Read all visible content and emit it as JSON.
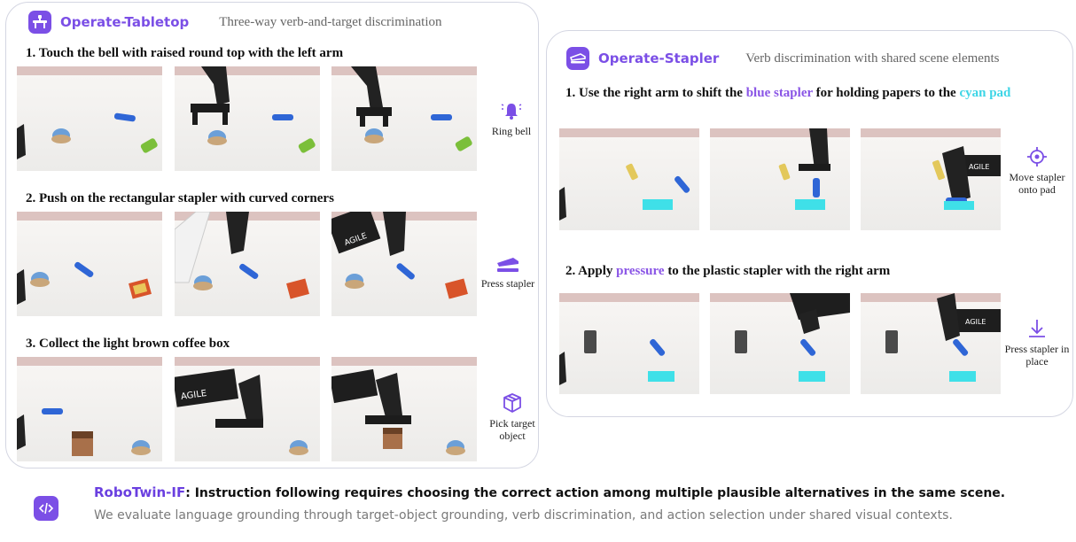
{
  "left_panel": {
    "title": "Operate-Tabletop",
    "subtitle": "Three-way verb-and-target discrimination",
    "tasks": [
      {
        "instruction": "1. Touch the bell with raised round top with the left arm",
        "action_label": "Ring bell",
        "icon": "bell-icon"
      },
      {
        "instruction": "2. Push on the rectangular stapler with curved corners",
        "action_label": "Press stapler",
        "icon": "stapler-icon"
      },
      {
        "instruction": "3. Collect the light brown coffee box",
        "action_label": "Pick target object",
        "icon": "box-icon"
      }
    ]
  },
  "right_panel": {
    "title": "Operate-Stapler",
    "subtitle": "Verb discrimination with shared scene elements",
    "tasks": [
      {
        "instruction_parts": [
          "1. Use the right arm to shift the ",
          "blue stapler",
          " for holding papers to the ",
          "cyan pad"
        ],
        "action_label": "Move stapler onto pad",
        "icon": "target-icon"
      },
      {
        "instruction_parts": [
          "2. Apply ",
          "pressure",
          " to the plastic stapler with the right arm"
        ],
        "action_label": "Press stapler in place",
        "icon": "arrow-down-icon"
      }
    ]
  },
  "footer": {
    "brand": "RoboTwin-IF",
    "headline": ": Instruction following requires choosing the correct action among multiple plausible alternatives in the same scene.",
    "description": "We evaluate language grounding through target-object grounding, verb discrimination, and action selection under shared visual contexts."
  },
  "colors": {
    "accent": "#7b4fe6",
    "highlight_purple": "#8a55e6",
    "highlight_cyan": "#3dd5e6",
    "border": "#d4d6e2"
  }
}
